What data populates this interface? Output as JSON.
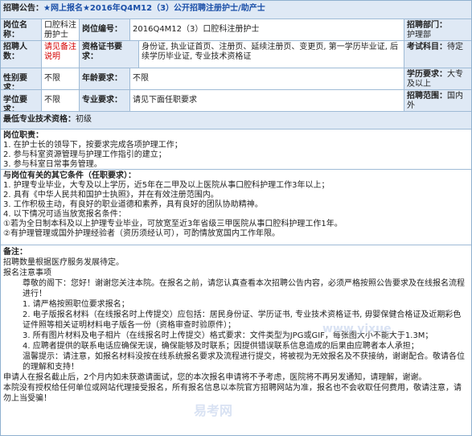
{
  "header": {
    "label": "招聘公告：",
    "title": "★网上报名★2016年Q4M12（3）公开招聘注册护士/助产士"
  },
  "row1": {
    "post_name_label": "岗位名称：",
    "post_name_value": "口腔科注册护士",
    "post_code_label": "岗位编号：",
    "post_code_value": "2016Q4M12（3）口腔科注册护士",
    "dept_label": "招聘部门：",
    "dept_value": "护理部"
  },
  "row2": {
    "count_label": "招聘人数：",
    "count_value": "请见备注说明",
    "certs_label": "资格证书要求：",
    "certs_value": "身份证, 执业证首页、注册页、延续注册页、变更页, 第一学历毕业证, 后续学历毕业证, 专业技术资格证",
    "exam_label": "考试科目：",
    "exam_value": "待定"
  },
  "row3": {
    "gender_label": "性别要求：",
    "gender_value": "不限",
    "age_label": "年龄要求：",
    "age_value": "不限",
    "edu_label": "学历要求：",
    "edu_value": "大专及以上"
  },
  "row4": {
    "degree_label": "学位要求：",
    "degree_value": "不限",
    "major_label": "专业要求：",
    "major_value": "请见下面任职要求",
    "scope_label": "招聘范围：",
    "scope_value": "国内外"
  },
  "row5": {
    "tech_label": "最低专业技术资格：",
    "tech_value": "初级"
  },
  "duties": {
    "title": "岗位职责：",
    "items": [
      "1. 在护士长的领导下，按要求完成各项护理工作；",
      "2. 参与科室资源管理与护理工作指引的建立；",
      "3. 参与科室日常事务管理。"
    ]
  },
  "conditions": {
    "title": "与岗位有关的其它条件（任职要求）：",
    "items": [
      "1. 护理专业毕业，大专及以上学历，近5年在二甲及以上医院从事口腔科护理工作3年以上；",
      "2. 具有《中华人民共和国护士执照》，并在有效注册范围内。",
      "3. 工作积极主动，有良好的职业道德和素养，具有良好的团队协助精神。",
      "4. 以下情况可适当放宽报名条件：",
      "①若为全日制本科及以上护理专业毕业，可放宽至近3年省级三甲医院从事口腔科护理工作1年。",
      "②有护理管理或国外护理经验者（资历须经认可），可酌情放宽国内工作年限。"
    ]
  },
  "remarks": {
    "title": "备注：",
    "lines": [
      "招聘数量根据医疗服务发展待定。",
      "报名注意事项",
      "尊敬的阁下：您好！谢谢您关注本院。在报名之前，请您认真查看本次招聘公告内容，必须严格按照公告要求及在线报名流程进行！",
      "1. 请严格按照职位要求报名；",
      "2. 电子版报名材料（在线报名时上传提交）应包括：居民身份证、学历证书, 专业技术资格证书, 毋婴保健合格证及近期彩色证件照等相关证明材料电子版各一份（资格审查时验原件）；",
      "3. 所有图片材料及电子相片（在线报名时上传提交）格式要求：文件类型为JPG或GIF，每张图大小不能大于1.3M；",
      "4. 应聘者提供的联系电话应确保无误，确保能够及时联系；因提供错误联系信息造成的后果由应聘者本人承担；",
      "温馨提示：请注意，如报名材料没按在线系统报名要求及流程进行提交，将被视为无效报名及不获接纳，谢谢配合。敬请各位的理解和支持！",
      "申请人在报名截止后，2个月内如未获邀请面试，您的本次报名申请将不予考虑，医院将不再另发通知，请理解，谢谢。",
      "本院没有授权给任何单位或网站代理接受报名，所有报名信息以本院官方招聘网站为准，报名也不会收取任何费用，敬请注意，请勿上当受骗！"
    ]
  },
  "watermark": {
    "text_cn": "易考网",
    "text_en": "www.yixue"
  }
}
